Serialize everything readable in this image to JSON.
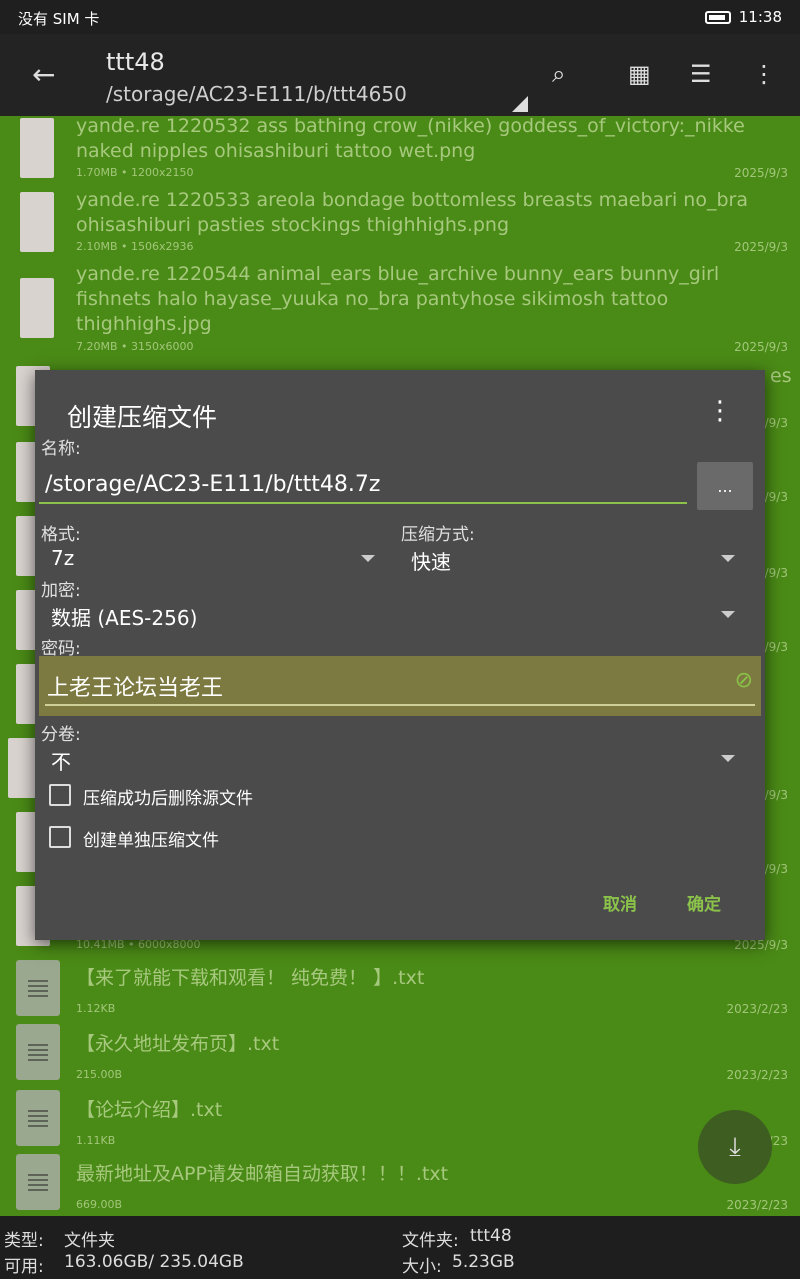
{
  "status": {
    "carrier": "没有 SIM 卡",
    "time": "11:38"
  },
  "appbar": {
    "title": "ttt48",
    "path": "/storage/AC23-E111/b/ttt4650",
    "back_icon": "arrow-left-icon",
    "icons": [
      "search-icon",
      "grid-icon",
      "list-icon",
      "more-vert-icon"
    ]
  },
  "files": [
    {
      "name": "yande.re 1220532 ass bathing crow_(nikke) goddess_of_victory:_nikke naked nipples ohisashiburi tattoo wet.png",
      "size": "1.70MB",
      "dims": "1200x2150",
      "date": "2025/9/3"
    },
    {
      "name": "yande.re 1220533 areola bondage bottomless breasts maebari no_bra ohisashiburi pasties stockings thighhighs.png",
      "size": "2.10MB",
      "dims": "1506x2936",
      "date": "2025/9/3"
    },
    {
      "name": "yande.re 1220544 animal_ears blue_archive bunny_ears bunny_girl fishnets halo hayase_yuuka no_bra pantyhose sikimosh tattoo thighhighs.jpg",
      "size": "7.20MB",
      "dims": "3150x6000",
      "date": "2025/9/3"
    }
  ],
  "files_lower": [
    {
      "name": "",
      "size": "10.41MB",
      "dims": "6000x8000",
      "date": "2025/9/3"
    }
  ],
  "text_files": [
    {
      "name": "【来了就能下载和观看！ 纯免费！ 】.txt",
      "size": "1.12KB",
      "date": "2023/2/23"
    },
    {
      "name": "【永久地址发布页】.txt",
      "size": "215.00B",
      "date": "2023/2/23"
    },
    {
      "name": "【论坛介绍】.txt",
      "size": "1.11KB",
      "date": "2023/2/23"
    },
    {
      "name": "最新地址及APP请发邮箱自动获取！！！.txt",
      "size": "669.00B",
      "date": "2023/2/23"
    }
  ],
  "hidden_dates": [
    "2025/9/3",
    "2025/9/3",
    "2025/9/3",
    "2025/9/3",
    "2025/9/3",
    "2025/9/3"
  ],
  "peek_text": "es",
  "dialog": {
    "title": "创建压缩文件",
    "name_label": "名称:",
    "name_value": "/storage/AC23-E111/b/ttt48.7z",
    "browse_label": "...",
    "format_label": "格式:",
    "format_value": "7z",
    "method_label": "压缩方式:",
    "method_value": "快速",
    "encrypt_label": "加密:",
    "encrypt_value": "数据 (AES-256)",
    "password_label": "密码:",
    "password_value": "上老王论坛当老王",
    "split_label": "分卷:",
    "split_value": "不",
    "delete_source_label": "压缩成功后删除源文件",
    "separate_archive_label": "创建单独压缩文件",
    "cancel_label": "取消",
    "ok_label": "确定"
  },
  "bottom": {
    "type_label": "类型:",
    "type_value": "文件夹",
    "avail_label": "可用:",
    "avail_value": "163.06GB/ 235.04GB",
    "folder_label": "文件夹:",
    "folder_value": "ttt48",
    "size_label": "大小:",
    "size_value": "5.23GB"
  }
}
